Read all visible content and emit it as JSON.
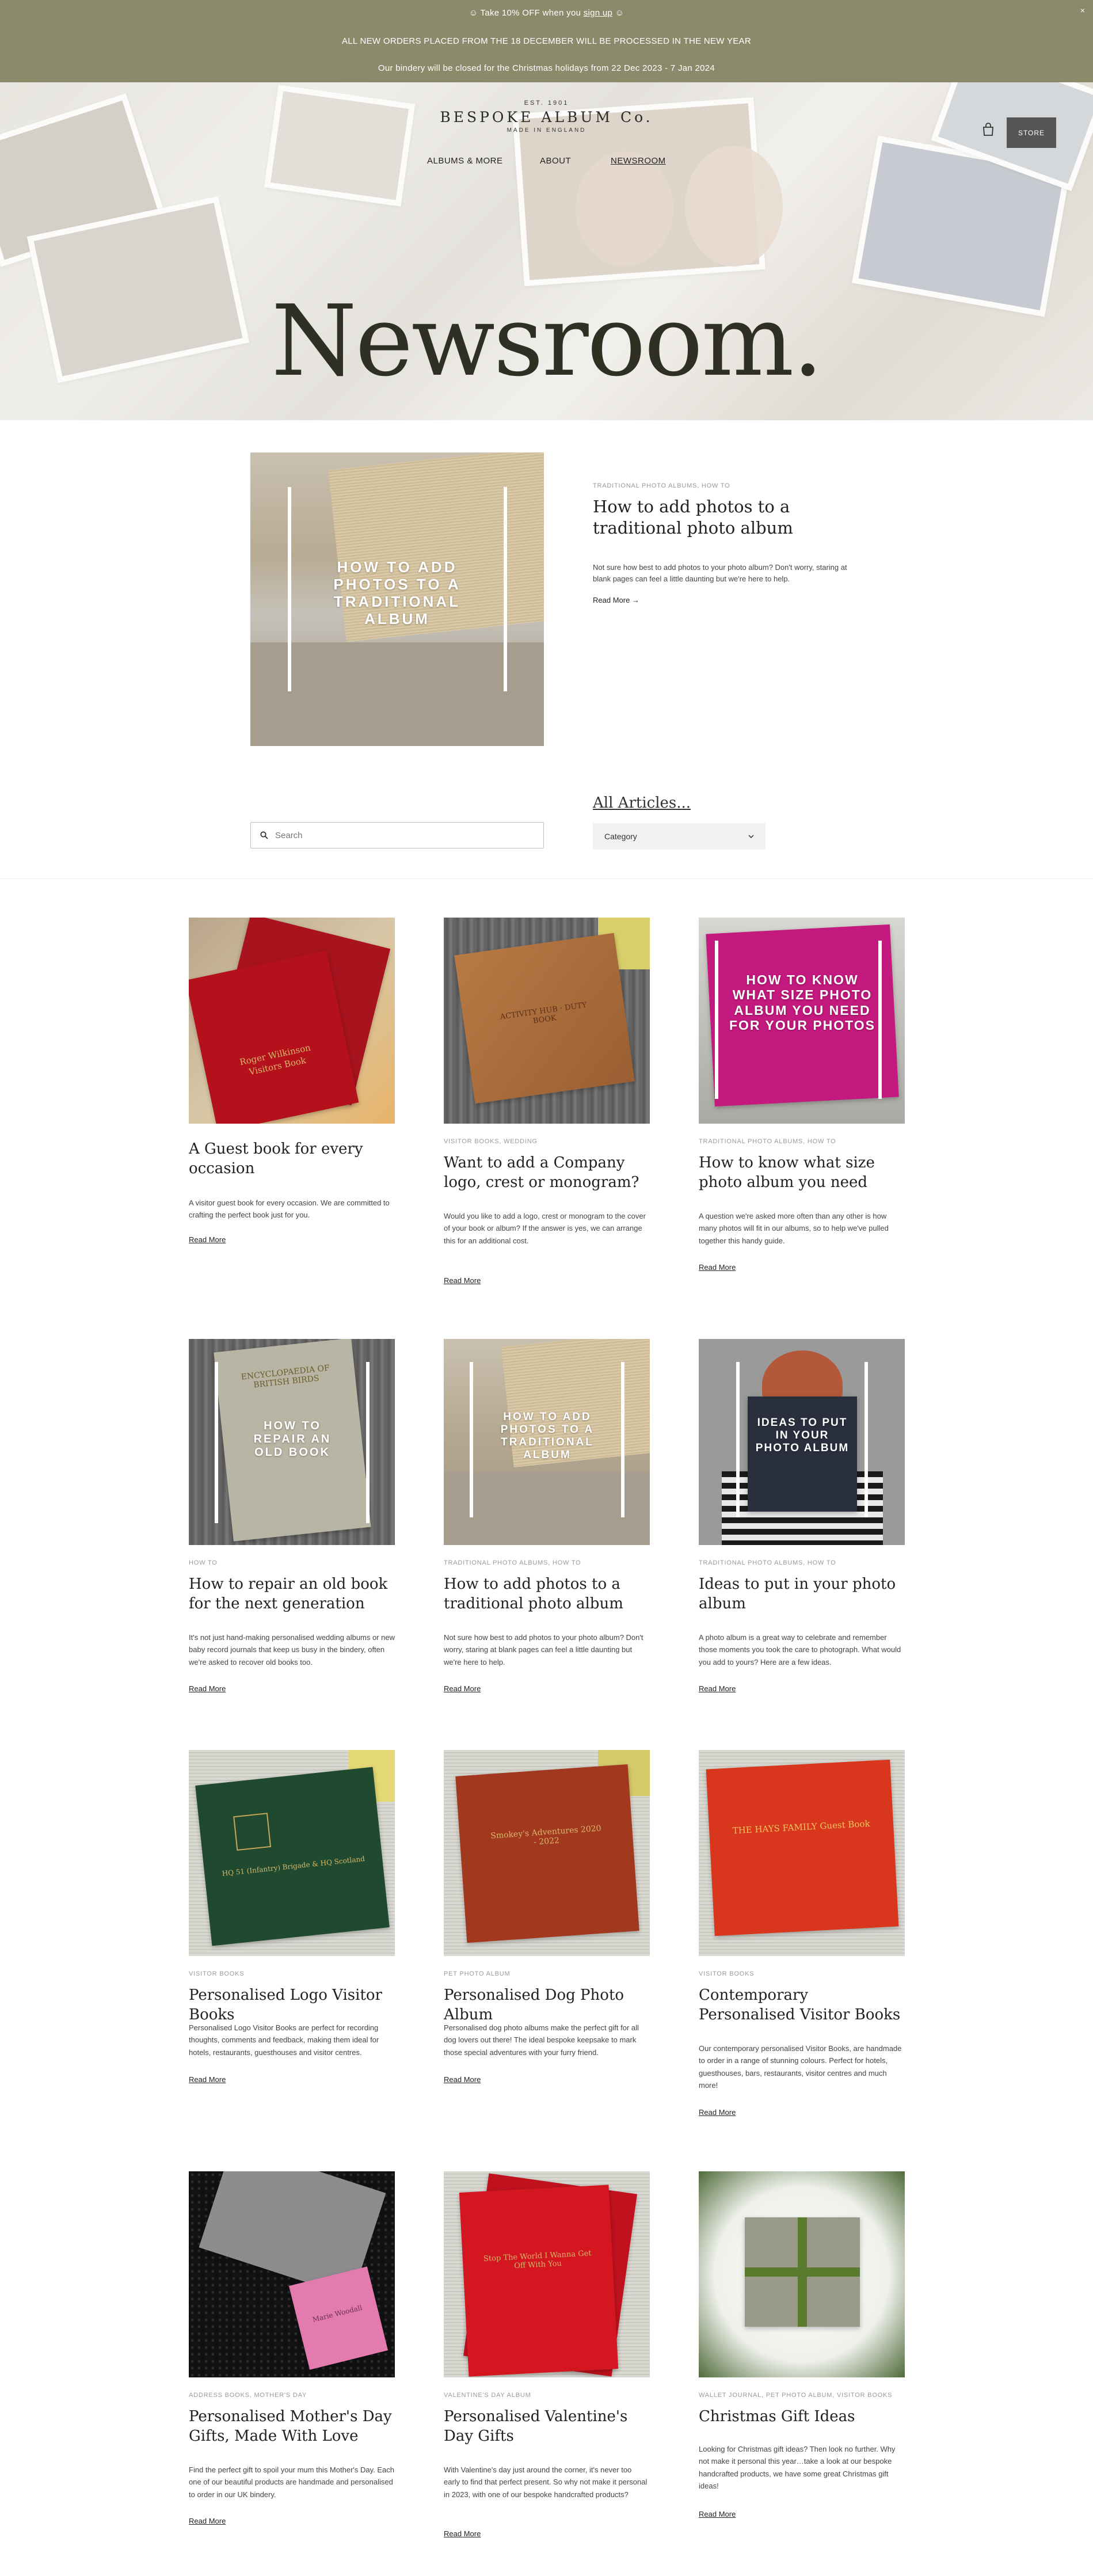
{
  "announcement": {
    "line1_prefix": "☺ Take 10% OFF when you ",
    "line1_link": "sign up",
    "line1_suffix": " ☺",
    "line2": "ALL NEW ORDERS PLACED FROM THE 18 DECEMBER WILL BE PROCESSED IN THE NEW YEAR",
    "line3": "Our bindery will be closed for the Christmas holidays from 22 Dec 2023 - 7 Jan 2024",
    "close": "×"
  },
  "brand": {
    "est": "EST. 1901",
    "name": "BESPOKE ALBUM Co.",
    "made": "MADE IN ENGLAND"
  },
  "nav": {
    "albums": "ALBUMS & MORE",
    "about": "ABOUT",
    "newsroom": "NEWSROOM",
    "store": "STORE"
  },
  "hero": {
    "title": "Newsroom."
  },
  "featured": {
    "overlay": "HOW TO ADD PHOTOS TO A TRADITIONAL ALBUM",
    "category": "TRADITIONAL PHOTO ALBUMS, HOW TO",
    "title": "How to add photos to a traditional photo album",
    "excerpt": "Not sure how best to add photos to your photo album? Don't worry, staring at blank pages can feel a little daunting but we're here to help.",
    "read_more": "Read More →"
  },
  "filters": {
    "search_placeholder": "Search",
    "all_articles": "All Articles...",
    "category_label": "Category"
  },
  "articles": [
    {
      "category": "",
      "title": "A Guest book for every occasion",
      "excerpt": "A visitor guest book for every occasion. We are committed to crafting the perfect book just for you.",
      "read_more": "Read More",
      "thumb_text": "Roger Wilkinson Visitors Book"
    },
    {
      "category": "VISITOR BOOKS, WEDDING",
      "title": "Want to add a Company logo, crest or monogram?",
      "excerpt": "Would you like to add a logo, crest or monogram to the cover of your book or album? If the answer is yes, we can arrange this for an additional cost.",
      "read_more": "Read More",
      "thumb_text": "ACTIVITY HUB · DUTY BOOK"
    },
    {
      "category": "TRADITIONAL PHOTO ALBUMS, HOW TO",
      "title": "How to know what size photo album you need",
      "excerpt": "A question we're asked more often than any other is how many photos will fit in our albums, so to help we've pulled together this handy guide.",
      "read_more": "Read More",
      "thumb_text": "HOW TO KNOW WHAT SIZE PHOTO ALBUM YOU NEED FOR YOUR PHOTOS"
    },
    {
      "category": "HOW TO",
      "title": "How to repair an old book for the next generation",
      "excerpt": "It's not just hand-making personalised wedding albums or new baby record journals that keep us busy in the bindery, often we're asked to recover old books too.",
      "read_more": "Read More",
      "thumb_text": "HOW TO REPAIR AN OLD BOOK",
      "thumb_book": "ENCYCLOPAEDIA OF BRITISH BIRDS"
    },
    {
      "category": "TRADITIONAL PHOTO ALBUMS, HOW TO",
      "title": "How to add photos to a traditional photo album",
      "excerpt": "Not sure how best to add photos to your photo album? Don't worry, staring at blank pages can feel a little daunting but we're here to help.",
      "read_more": "Read More",
      "thumb_text": "HOW TO ADD PHOTOS TO A TRADITIONAL ALBUM"
    },
    {
      "category": "TRADITIONAL PHOTO ALBUMS, HOW TO",
      "title": "Ideas to put in your photo album",
      "excerpt": "A photo album is a great way to celebrate and remember those moments you took the care to photograph. What would you add to yours? Here are a few ideas.",
      "read_more": "Read More",
      "thumb_text": "IDEAS TO PUT IN YOUR PHOTO ALBUM"
    },
    {
      "category": "VISITOR BOOKS",
      "title": "Personalised Logo Visitor Books",
      "excerpt": "Personalised Logo Visitor Books are perfect for recording thoughts, comments and feedback, making them ideal for hotels, restaurants, guesthouses and visitor centres.",
      "read_more": "Read More",
      "thumb_text": "HQ 51 (Infantry) Brigade & HQ Scotland"
    },
    {
      "category": "PET PHOTO ALBUM",
      "title": "Personalised Dog Photo Album",
      "excerpt": "Personalised dog photo albums make the perfect gift for all dog lovers out there! The ideal bespoke keepsake to mark those special adventures with your furry friend.",
      "read_more": "Read More",
      "thumb_text": "Smokey's Adventures 2020 - 2022"
    },
    {
      "category": "VISITOR BOOKS",
      "title": "Contemporary Personalised Visitor Books",
      "excerpt": "Our contemporary personalised Visitor Books, are handmade to order in a range of stunning colours. Perfect for hotels, guesthouses, bars, restaurants, visitor centres and much more!",
      "read_more": "Read More",
      "thumb_text": "THE HAYS FAMILY Guest Book"
    },
    {
      "category": "ADDRESS BOOKS, MOTHER'S DAY",
      "title": "Personalised Mother's Day Gifts, Made With Love",
      "excerpt": "Find the perfect gift to spoil your mum this Mother's Day. Each one of our beautiful products are handmade and personalised to order in our UK bindery.",
      "read_more": "Read More",
      "thumb_text": "Marie Woodall"
    },
    {
      "category": "VALENTINE'S DAY ALBUM",
      "title": "Personalised Valentine's Day Gifts",
      "excerpt": "With Valentine's day just around the corner, it's never too early to find that perfect present. So why not make it personal in 2023, with one of our bespoke handcrafted products?",
      "read_more": "Read More",
      "thumb_text": "Stop The World I Wanna Get Off With You"
    },
    {
      "category": "WALLET JOURNAL, PET PHOTO ALBUM, VISITOR BOOKS",
      "title": "Christmas Gift Ideas",
      "excerpt": "Looking for Christmas gift ideas? Then look no further. Why not make it personal this year…take a look at our bespoke handcrafted products, we have some great Christmas gift ideas!",
      "read_more": "Read More",
      "thumb_text": ""
    }
  ]
}
